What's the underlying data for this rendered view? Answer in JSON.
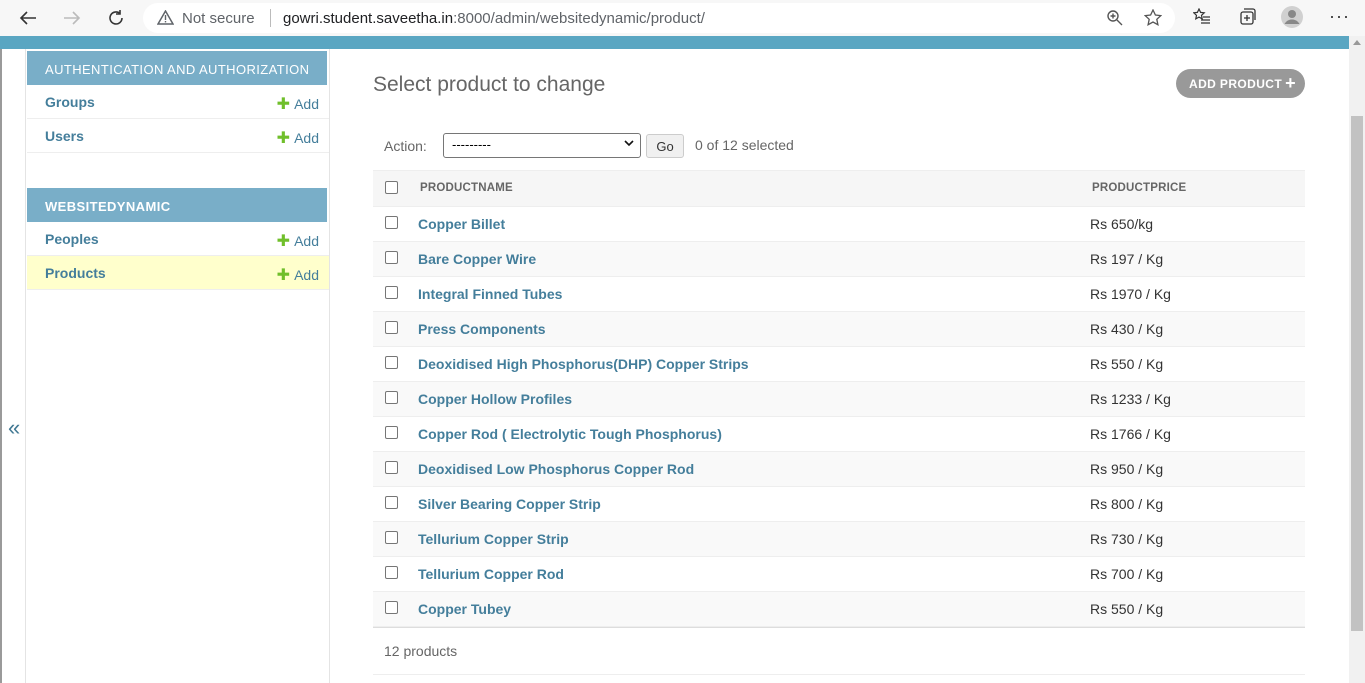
{
  "browser": {
    "security_label": "Not secure",
    "url_host": "gowri.student.saveetha.in",
    "url_path": ":8000/admin/websitedynamic/product/"
  },
  "sidebar": {
    "modules": [
      {
        "caption": "AUTHENTICATION AND AUTHORIZATION",
        "items": [
          {
            "label": "Groups",
            "add": "Add"
          },
          {
            "label": "Users",
            "add": "Add"
          }
        ]
      },
      {
        "caption": "WEBSITEDYNAMIC",
        "items": [
          {
            "label": "Peoples",
            "add": "Add"
          },
          {
            "label": "Products",
            "add": "Add"
          }
        ]
      }
    ],
    "toggle": "«"
  },
  "main": {
    "title": "Select product to change",
    "add_button": "ADD PRODUCT",
    "action_label": "Action:",
    "action_selected": "---------",
    "go_label": "Go",
    "selection_count": "0 of 12 selected",
    "columns": [
      "PRODUCTNAME",
      "PRODUCTPRICE"
    ],
    "rows": [
      {
        "name": "Copper Billet",
        "price": "Rs 650/kg"
      },
      {
        "name": "Bare Copper Wire",
        "price": "Rs 197 / Kg"
      },
      {
        "name": "Integral Finned Tubes",
        "price": "Rs 1970 / Kg"
      },
      {
        "name": "Press Components",
        "price": "Rs 430 / Kg"
      },
      {
        "name": "Deoxidised High Phosphorus(DHP) Copper Strips",
        "price": "Rs 550 / Kg"
      },
      {
        "name": "Copper Hollow Profiles",
        "price": "Rs 1233 / Kg"
      },
      {
        "name": "Copper Rod ( Electrolytic Tough Phosphorus)",
        "price": "Rs 1766 / Kg"
      },
      {
        "name": "Deoxidised Low Phosphorus Copper Rod",
        "price": "Rs 950 / Kg"
      },
      {
        "name": "Silver Bearing Copper Strip",
        "price": "Rs 800 / Kg"
      },
      {
        "name": "Tellurium Copper Strip",
        "price": "Rs 730 / Kg"
      },
      {
        "name": "Tellurium Copper Rod",
        "price": "Rs 700 / Kg"
      },
      {
        "name": "Copper Tubey",
        "price": "Rs 550 / Kg"
      }
    ],
    "paginator": "12 products"
  }
}
